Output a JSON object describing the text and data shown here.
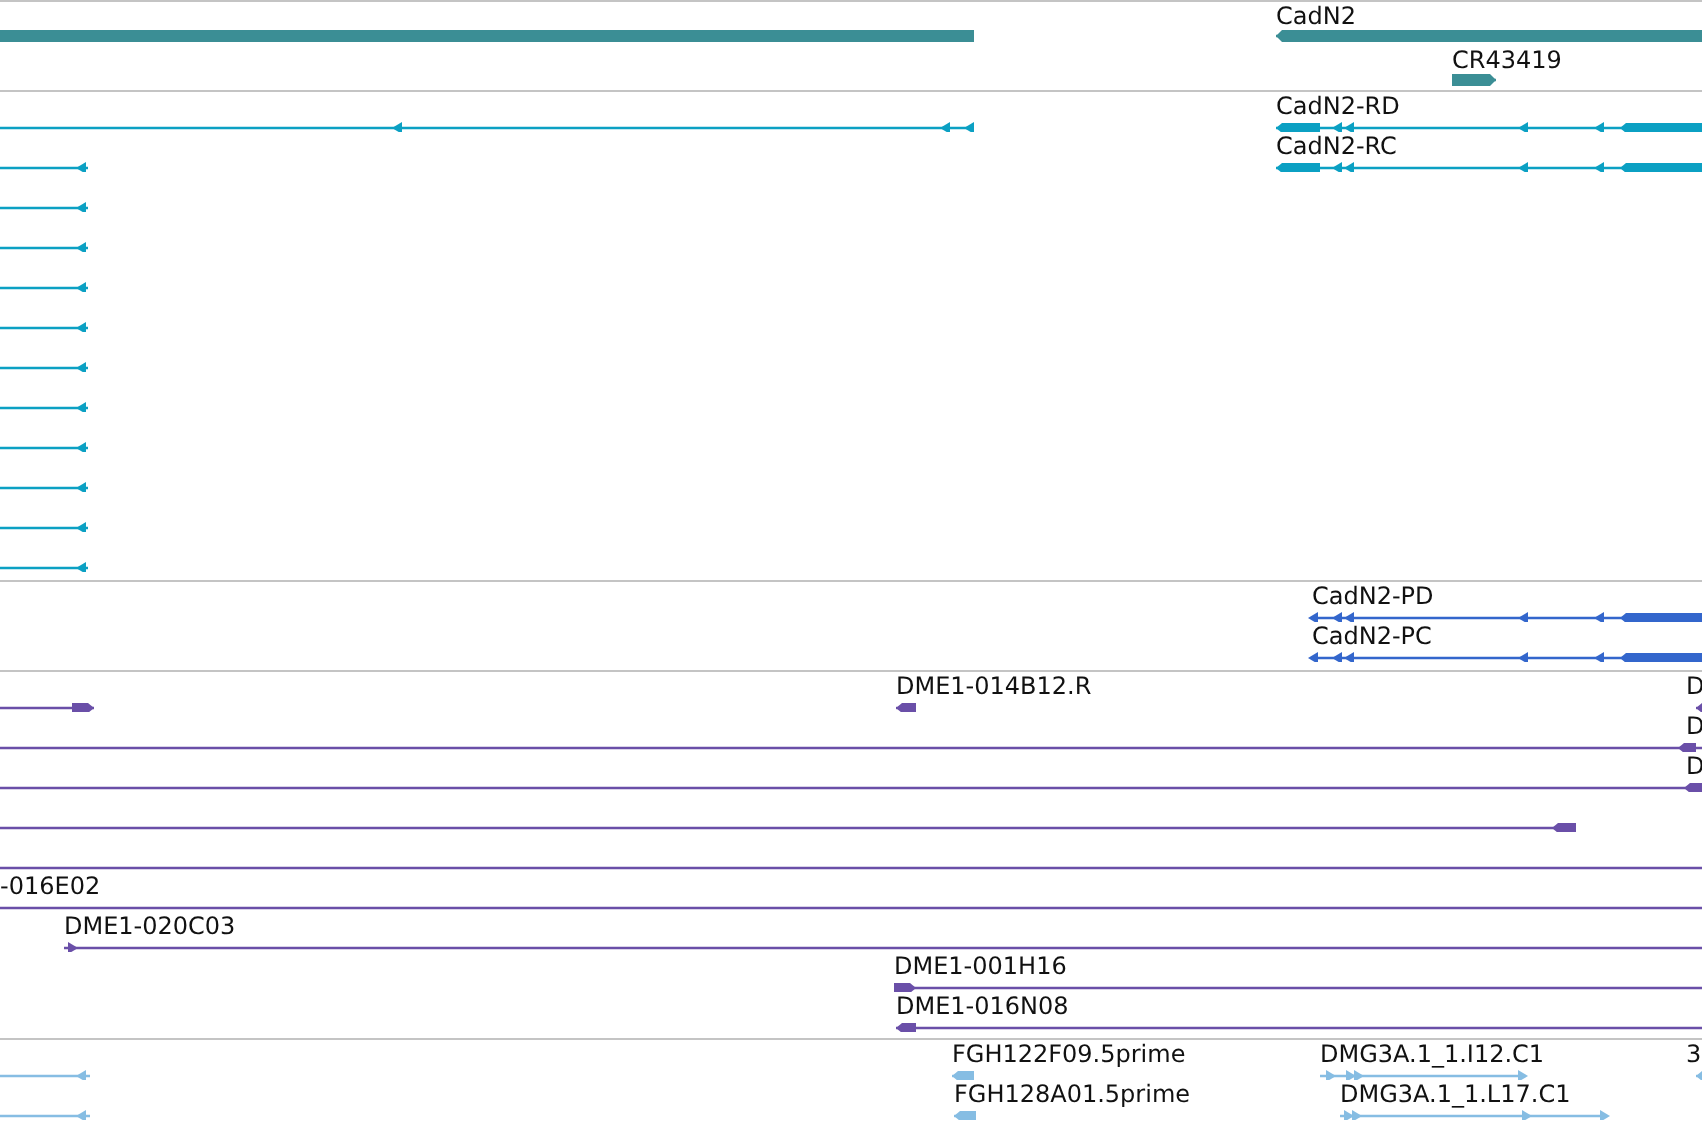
{
  "tracks": [
    {
      "kind": "gene",
      "rows": [
        {
          "features": [
            {
              "kind": "plain"
            },
            {
              "kind": "arrowed",
              "label": "CadN2",
              "reverse": true
            }
          ]
        },
        {
          "features": [
            {
              "kind": "arrowed",
              "label": "CR43419",
              "reverse": false
            }
          ]
        }
      ]
    },
    {
      "kind": "transcript",
      "rows": [
        {
          "features": [
            {
              "kind": "arrowed",
              "reverse": true
            },
            {
              "kind": "arrowed",
              "label": "CadN2-RD",
              "reverse": true
            }
          ]
        },
        {
          "features": [
            {
              "kind": "arrowed",
              "reverse": true
            },
            {
              "kind": "arrowed",
              "label": "CadN2-RC",
              "reverse": true
            }
          ]
        },
        {
          "features": [
            {
              "kind": "arrowed",
              "reverse": true
            }
          ]
        },
        {
          "features": [
            {
              "kind": "arrowed",
              "reverse": true
            }
          ]
        },
        {
          "features": [
            {
              "kind": "arrowed",
              "reverse": true
            }
          ]
        },
        {
          "features": [
            {
              "kind": "arrowed",
              "reverse": true
            }
          ]
        },
        {
          "features": [
            {
              "kind": "arrowed",
              "reverse": true
            }
          ]
        },
        {
          "features": [
            {
              "kind": "arrowed",
              "reverse": true
            }
          ]
        },
        {
          "features": [
            {
              "kind": "arrowed",
              "reverse": true
            }
          ]
        },
        {
          "features": [
            {
              "kind": "arrowed",
              "reverse": true
            }
          ]
        },
        {
          "features": [
            {
              "kind": "arrowed",
              "reverse": true
            }
          ]
        },
        {
          "features": [
            {
              "kind": "arrowed",
              "reverse": true
            }
          ]
        }
      ]
    },
    {
      "kind": "protein",
      "rows": [
        {
          "features": [
            {
              "kind": "arrowed",
              "label": "CadN2-PD",
              "reverse": true
            }
          ]
        },
        {
          "features": [
            {
              "kind": "arrowed",
              "label": "CadN2-PC",
              "reverse": true
            }
          ]
        }
      ]
    },
    {
      "kind": "est",
      "rows": [
        {
          "features": [
            {
              "kind": "arrowed",
              "reverse": false
            },
            {
              "kind": "arrowed",
              "label": "DME1-014B12.R",
              "reverse": true
            },
            {
              "kind": "arrowed",
              "label": "D",
              "reverse": true
            }
          ]
        },
        {
          "features": [
            {
              "kind": "arrowed",
              "label": "D",
              "reverse": true
            }
          ]
        },
        {
          "features": [
            {
              "kind": "arrowed",
              "label": "D",
              "reverse": true
            }
          ]
        },
        {
          "features": [
            {
              "kind": "arrowed",
              "reverse": true
            }
          ]
        },
        {
          "features": [
            {
              "kind": "plain"
            }
          ]
        },
        {
          "features": [
            {
              "kind": "plain",
              "label": "-016E02"
            }
          ]
        },
        {
          "features": [
            {
              "kind": "arrowed",
              "label": "DME1-020C03",
              "reverse": false
            }
          ]
        },
        {
          "features": [
            {
              "kind": "arrowed",
              "label": "DME1-001H16",
              "reverse": false
            }
          ]
        },
        {
          "features": [
            {
              "kind": "arrowed",
              "label": "DME1-016N08",
              "reverse": true
            }
          ]
        }
      ]
    },
    {
      "kind": "cdna",
      "rows": [
        {
          "features": [
            {
              "kind": "arrowed",
              "reverse": true
            },
            {
              "kind": "arrowed",
              "label": "FGH122F09.5prime",
              "reverse": true
            },
            {
              "kind": "arrowed",
              "label": "DMG3A.1_1.I12.C1",
              "reverse": false
            },
            {
              "kind": "arrowed",
              "label": "3",
              "reverse": true
            }
          ]
        },
        {
          "features": [
            {
              "kind": "arrowed",
              "reverse": true
            },
            {
              "kind": "arrowed",
              "label": "FGH128A01.5prime",
              "reverse": true
            },
            {
              "kind": "arrowed",
              "label": "DMG3A.1_1.L17.C1",
              "reverse": false
            }
          ]
        }
      ]
    }
  ]
}
